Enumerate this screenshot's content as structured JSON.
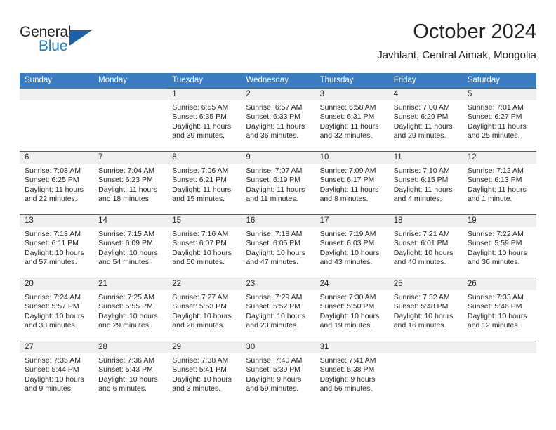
{
  "branding": {
    "logo_text_primary": "General",
    "logo_text_secondary": "Blue",
    "accent_color": "#1f7fc4",
    "logo_triangle_color": "#1a5fa8"
  },
  "header": {
    "title": "October 2024",
    "subtitle": "Javhlant, Central Aimak, Mongolia"
  },
  "calendar": {
    "header_background": "#3a7dc0",
    "row_divider_color": "#1f6cb0",
    "daynum_band_color": "#efefef",
    "weekday_headers": [
      "Sunday",
      "Monday",
      "Tuesday",
      "Wednesday",
      "Thursday",
      "Friday",
      "Saturday"
    ],
    "weeks": [
      [
        {
          "day": "",
          "empty": true
        },
        {
          "day": "",
          "empty": true
        },
        {
          "day": "1",
          "sunrise": "Sunrise: 6:55 AM",
          "sunset": "Sunset: 6:35 PM",
          "daylight": "Daylight: 11 hours and 39 minutes."
        },
        {
          "day": "2",
          "sunrise": "Sunrise: 6:57 AM",
          "sunset": "Sunset: 6:33 PM",
          "daylight": "Daylight: 11 hours and 36 minutes."
        },
        {
          "day": "3",
          "sunrise": "Sunrise: 6:58 AM",
          "sunset": "Sunset: 6:31 PM",
          "daylight": "Daylight: 11 hours and 32 minutes."
        },
        {
          "day": "4",
          "sunrise": "Sunrise: 7:00 AM",
          "sunset": "Sunset: 6:29 PM",
          "daylight": "Daylight: 11 hours and 29 minutes."
        },
        {
          "day": "5",
          "sunrise": "Sunrise: 7:01 AM",
          "sunset": "Sunset: 6:27 PM",
          "daylight": "Daylight: 11 hours and 25 minutes."
        }
      ],
      [
        {
          "day": "6",
          "sunrise": "Sunrise: 7:03 AM",
          "sunset": "Sunset: 6:25 PM",
          "daylight": "Daylight: 11 hours and 22 minutes."
        },
        {
          "day": "7",
          "sunrise": "Sunrise: 7:04 AM",
          "sunset": "Sunset: 6:23 PM",
          "daylight": "Daylight: 11 hours and 18 minutes."
        },
        {
          "day": "8",
          "sunrise": "Sunrise: 7:06 AM",
          "sunset": "Sunset: 6:21 PM",
          "daylight": "Daylight: 11 hours and 15 minutes."
        },
        {
          "day": "9",
          "sunrise": "Sunrise: 7:07 AM",
          "sunset": "Sunset: 6:19 PM",
          "daylight": "Daylight: 11 hours and 11 minutes."
        },
        {
          "day": "10",
          "sunrise": "Sunrise: 7:09 AM",
          "sunset": "Sunset: 6:17 PM",
          "daylight": "Daylight: 11 hours and 8 minutes."
        },
        {
          "day": "11",
          "sunrise": "Sunrise: 7:10 AM",
          "sunset": "Sunset: 6:15 PM",
          "daylight": "Daylight: 11 hours and 4 minutes."
        },
        {
          "day": "12",
          "sunrise": "Sunrise: 7:12 AM",
          "sunset": "Sunset: 6:13 PM",
          "daylight": "Daylight: 11 hours and 1 minute."
        }
      ],
      [
        {
          "day": "13",
          "sunrise": "Sunrise: 7:13 AM",
          "sunset": "Sunset: 6:11 PM",
          "daylight": "Daylight: 10 hours and 57 minutes."
        },
        {
          "day": "14",
          "sunrise": "Sunrise: 7:15 AM",
          "sunset": "Sunset: 6:09 PM",
          "daylight": "Daylight: 10 hours and 54 minutes."
        },
        {
          "day": "15",
          "sunrise": "Sunrise: 7:16 AM",
          "sunset": "Sunset: 6:07 PM",
          "daylight": "Daylight: 10 hours and 50 minutes."
        },
        {
          "day": "16",
          "sunrise": "Sunrise: 7:18 AM",
          "sunset": "Sunset: 6:05 PM",
          "daylight": "Daylight: 10 hours and 47 minutes."
        },
        {
          "day": "17",
          "sunrise": "Sunrise: 7:19 AM",
          "sunset": "Sunset: 6:03 PM",
          "daylight": "Daylight: 10 hours and 43 minutes."
        },
        {
          "day": "18",
          "sunrise": "Sunrise: 7:21 AM",
          "sunset": "Sunset: 6:01 PM",
          "daylight": "Daylight: 10 hours and 40 minutes."
        },
        {
          "day": "19",
          "sunrise": "Sunrise: 7:22 AM",
          "sunset": "Sunset: 5:59 PM",
          "daylight": "Daylight: 10 hours and 36 minutes."
        }
      ],
      [
        {
          "day": "20",
          "sunrise": "Sunrise: 7:24 AM",
          "sunset": "Sunset: 5:57 PM",
          "daylight": "Daylight: 10 hours and 33 minutes."
        },
        {
          "day": "21",
          "sunrise": "Sunrise: 7:25 AM",
          "sunset": "Sunset: 5:55 PM",
          "daylight": "Daylight: 10 hours and 29 minutes."
        },
        {
          "day": "22",
          "sunrise": "Sunrise: 7:27 AM",
          "sunset": "Sunset: 5:53 PM",
          "daylight": "Daylight: 10 hours and 26 minutes."
        },
        {
          "day": "23",
          "sunrise": "Sunrise: 7:29 AM",
          "sunset": "Sunset: 5:52 PM",
          "daylight": "Daylight: 10 hours and 23 minutes."
        },
        {
          "day": "24",
          "sunrise": "Sunrise: 7:30 AM",
          "sunset": "Sunset: 5:50 PM",
          "daylight": "Daylight: 10 hours and 19 minutes."
        },
        {
          "day": "25",
          "sunrise": "Sunrise: 7:32 AM",
          "sunset": "Sunset: 5:48 PM",
          "daylight": "Daylight: 10 hours and 16 minutes."
        },
        {
          "day": "26",
          "sunrise": "Sunrise: 7:33 AM",
          "sunset": "Sunset: 5:46 PM",
          "daylight": "Daylight: 10 hours and 12 minutes."
        }
      ],
      [
        {
          "day": "27",
          "sunrise": "Sunrise: 7:35 AM",
          "sunset": "Sunset: 5:44 PM",
          "daylight": "Daylight: 10 hours and 9 minutes."
        },
        {
          "day": "28",
          "sunrise": "Sunrise: 7:36 AM",
          "sunset": "Sunset: 5:43 PM",
          "daylight": "Daylight: 10 hours and 6 minutes."
        },
        {
          "day": "29",
          "sunrise": "Sunrise: 7:38 AM",
          "sunset": "Sunset: 5:41 PM",
          "daylight": "Daylight: 10 hours and 3 minutes."
        },
        {
          "day": "30",
          "sunrise": "Sunrise: 7:40 AM",
          "sunset": "Sunset: 5:39 PM",
          "daylight": "Daylight: 9 hours and 59 minutes."
        },
        {
          "day": "31",
          "sunrise": "Sunrise: 7:41 AM",
          "sunset": "Sunset: 5:38 PM",
          "daylight": "Daylight: 9 hours and 56 minutes."
        },
        {
          "day": "",
          "empty": true
        },
        {
          "day": "",
          "empty": true
        }
      ]
    ]
  }
}
